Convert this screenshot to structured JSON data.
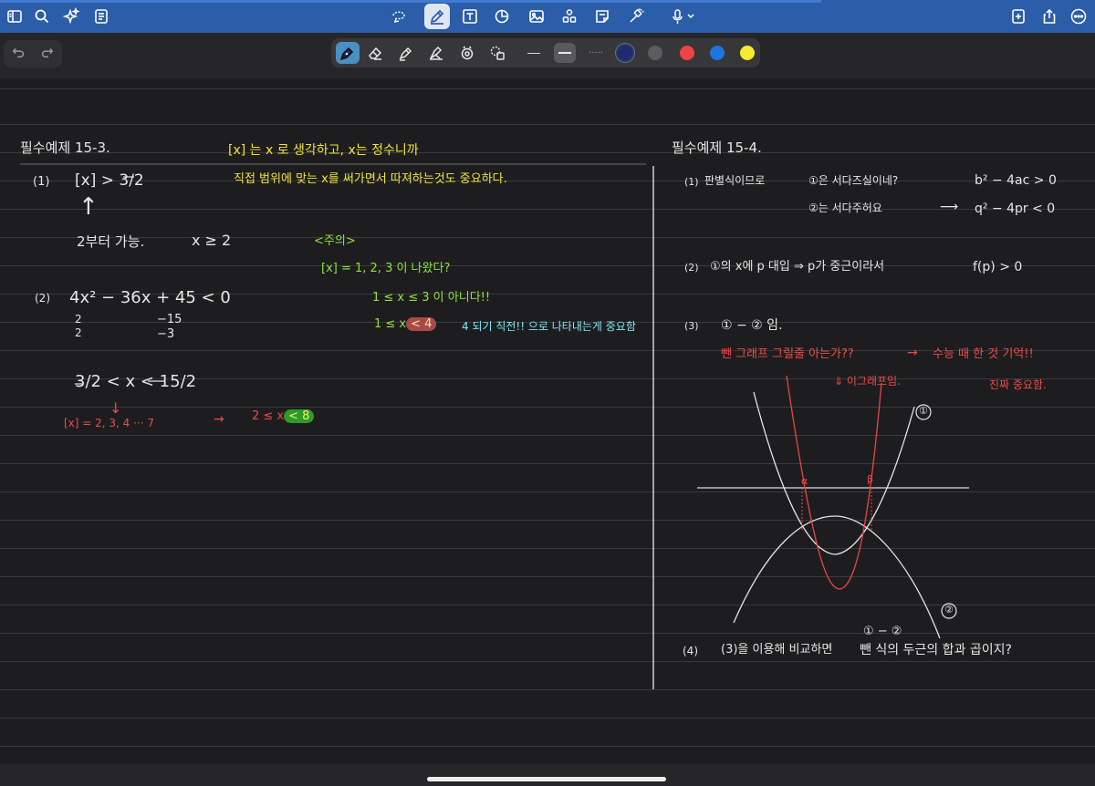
{
  "colors": {
    "toolbar_bg": "#2b5da8",
    "paper_bg": "#1d1d1f",
    "ink_white": "#e6e6e6",
    "ink_yellow": "#f2e33c",
    "ink_green": "#8ee23f",
    "ink_cyan": "#7fe6f0",
    "ink_red": "#ef4a4a",
    "pen_red": "#ef4444",
    "pen_blue": "#1f74e0",
    "pen_yellow": "#f5ea2f",
    "pen_gray": "#5c5c60",
    "pen_navy": "#1f2a70"
  },
  "toolbar": {
    "left_icons": [
      "sidebar-icon",
      "search-icon",
      "sparkle-icon",
      "document-icon"
    ],
    "center_icons": [
      "lasso-icon",
      "pen-icon",
      "textbox-icon",
      "shape-icon",
      "image-icon",
      "elements-icon",
      "sticky-note-icon",
      "laser-icon",
      "microphone-icon"
    ],
    "right_icons": [
      "add-page-icon",
      "share-icon",
      "more-icon"
    ]
  },
  "pen_tray": {
    "tools": [
      "fountain-pen-icon",
      "eraser-icon",
      "highlighter-icon",
      "tape-icon",
      "shape-recognition-icon",
      "lasso-tool-icon"
    ],
    "colors": [
      "#1f2a70",
      "#5c5c60",
      "#ef4444",
      "#1f74e0",
      "#f5ea2f"
    ],
    "thickness_dots": "·····"
  },
  "notes": {
    "left": {
      "title": "필수예제 15-3.",
      "p1_label": "(1)",
      "p1_expr": "[x] > 3/2",
      "p1_arrow": "↑",
      "p1_note": "2부터 가능.",
      "p1_result": "x ≥ 2",
      "p2_label": "(2)",
      "p2_expr": "4x² − 36x + 45 < 0",
      "p2_factor_left_top": "2",
      "p2_factor_left_bot": "2",
      "p2_factor_right_top": "−15",
      "p2_factor_right_bot": "−3",
      "p2_range": "3/2 < x < 15/2",
      "p2_arrow": "↓",
      "p2_values": "[x] = 2, 3, 4 ··· 7",
      "p2_implies": "→",
      "p2_result_pre": "2 ≤ x",
      "p2_result_hl": "< 8"
    },
    "middle": {
      "line1": "[x] 는 x 로 생각하고, x는 정수니까",
      "line2": "직접 범위에 맞는 x를 써가면서 따져하는것도 중요하다.",
      "caution": "<주의>",
      "c1": "[x] = 1, 2, 3 이 나왔다?",
      "c2": "1 ≤ x ≤ 3 이 아니다!!",
      "c3_pre": "1 ≤ x",
      "c3_hl": "< 4",
      "c3_post": "4 되기 직전!! 으로 나타내는게 중요함"
    },
    "right": {
      "title": "필수예제 15-4.",
      "r1_label": "(1)",
      "r1_text": "판별식이므로",
      "r1_a": "①은  서다즈실이네?",
      "r1_a_expr": "b² − 4ac > 0",
      "r1_b": "②는  서다주허요",
      "r1_b_arrow": "⟶",
      "r1_b_expr": "q² − 4pr < 0",
      "r2_label": "(2)",
      "r2_text": "①의 x에  p 대입 ⇒  p가 중근이라서",
      "r2_expr": "f(p) > 0",
      "r3_label": "(3)",
      "r3_text": "① − ② 임.",
      "r3_red1": "뺀 그래프 그릴줄 아는가??",
      "r3_red1_arrow": "→",
      "r3_red1_b": "수능 때 한 것 기억!!",
      "r3_red2": "⇓ 이그래프임.",
      "r3_red3": "진짜 중요함.",
      "graph_label1": "①",
      "graph_label2": "②",
      "graph_alpha": "α",
      "graph_beta": "β",
      "r4_top": "① − ②",
      "r4_label": "(4)",
      "r4_text": "(3)을 이용해 비교하면",
      "r4_text2": "뺀 식의 두근의 합과 곱이지?"
    }
  }
}
